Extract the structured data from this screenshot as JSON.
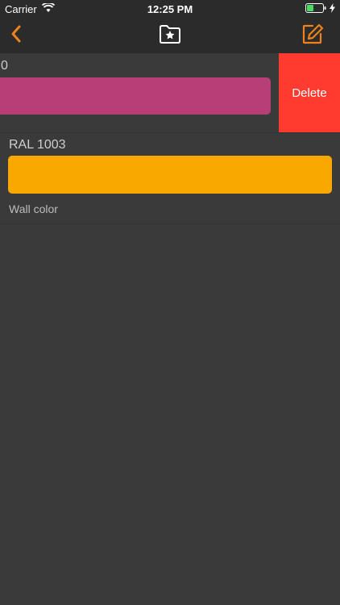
{
  "status_bar": {
    "carrier": "Carrier",
    "time": "12:25 PM"
  },
  "nav": {
    "back_icon": "chevron-left-icon",
    "center_icon": "folder-star-icon",
    "edit_icon": "compose-icon",
    "accent_color": "#f0821e"
  },
  "colors": [
    {
      "title": "0",
      "swatch": "#b83e78",
      "note": ""
    },
    {
      "title": "RAL 1003",
      "swatch": "#f9a800",
      "note": "Wall color"
    }
  ],
  "swipe_action": {
    "label": "Delete",
    "color": "#ff3b30"
  }
}
